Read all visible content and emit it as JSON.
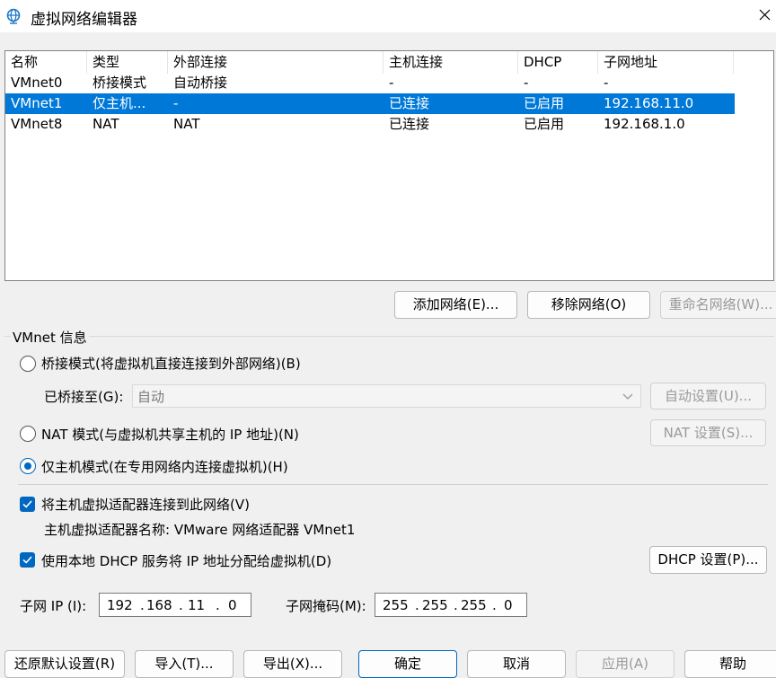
{
  "window": {
    "title": "虚拟网络编辑器"
  },
  "table": {
    "headers": [
      "名称",
      "类型",
      "外部连接",
      "主机连接",
      "DHCP",
      "子网地址"
    ],
    "rows": [
      [
        "VMnet0",
        "桥接模式",
        "自动桥接",
        "-",
        "-",
        "-"
      ],
      [
        "VMnet1",
        "仅主机...",
        "-",
        "已连接",
        "已启用",
        "192.168.11.0"
      ],
      [
        "VMnet8",
        "NAT",
        "NAT",
        "已连接",
        "已启用",
        "192.168.1.0"
      ]
    ],
    "selected_row": 1
  },
  "list_buttons": {
    "add": "添加网络(E)...",
    "remove": "移除网络(O)",
    "rename": "重命名网络(W)..."
  },
  "info": {
    "group_title": "VMnet 信息",
    "bridge_mode": "桥接模式(将虚拟机直接连接到外部网络)(B)",
    "bridged_to_label": "已桥接至(G):",
    "bridged_to_value": "自动",
    "auto_settings": "自动设置(U)...",
    "nat_mode": "NAT 模式(与虚拟机共享主机的 IP 地址)(N)",
    "nat_settings": "NAT 设置(S)...",
    "host_only_mode": "仅主机模式(在专用网络内连接虚拟机)(H)",
    "selected_mode": "host_only",
    "connect_adapter": "将主机虚拟适配器连接到此网络(V)",
    "connect_adapter_checked": true,
    "adapter_name_line": "主机虚拟适配器名称: VMware 网络适配器 VMnet1",
    "use_dhcp": "使用本地 DHCP 服务将 IP 地址分配给虚拟机(D)",
    "use_dhcp_checked": true,
    "dhcp_settings": "DHCP 设置(P)...",
    "subnet_ip_label": "子网 IP (I):",
    "subnet_ip": [
      "192",
      "168",
      "11",
      "0"
    ],
    "subnet_mask_label": "子网掩码(M):",
    "subnet_mask": [
      "255",
      "255",
      "255",
      "0"
    ]
  },
  "footer": {
    "restore": "还原默认设置(R)",
    "import": "导入(T)...",
    "export": "导出(X)...",
    "ok": "确定",
    "cancel": "取消",
    "apply": "应用(A)",
    "help": "帮助"
  },
  "colors": {
    "accent": "#0078d7",
    "check": "#0067c0"
  },
  "icons": {
    "app": "globe-network-icon",
    "close": "close-icon",
    "dropdown": "chevron-down-icon"
  }
}
